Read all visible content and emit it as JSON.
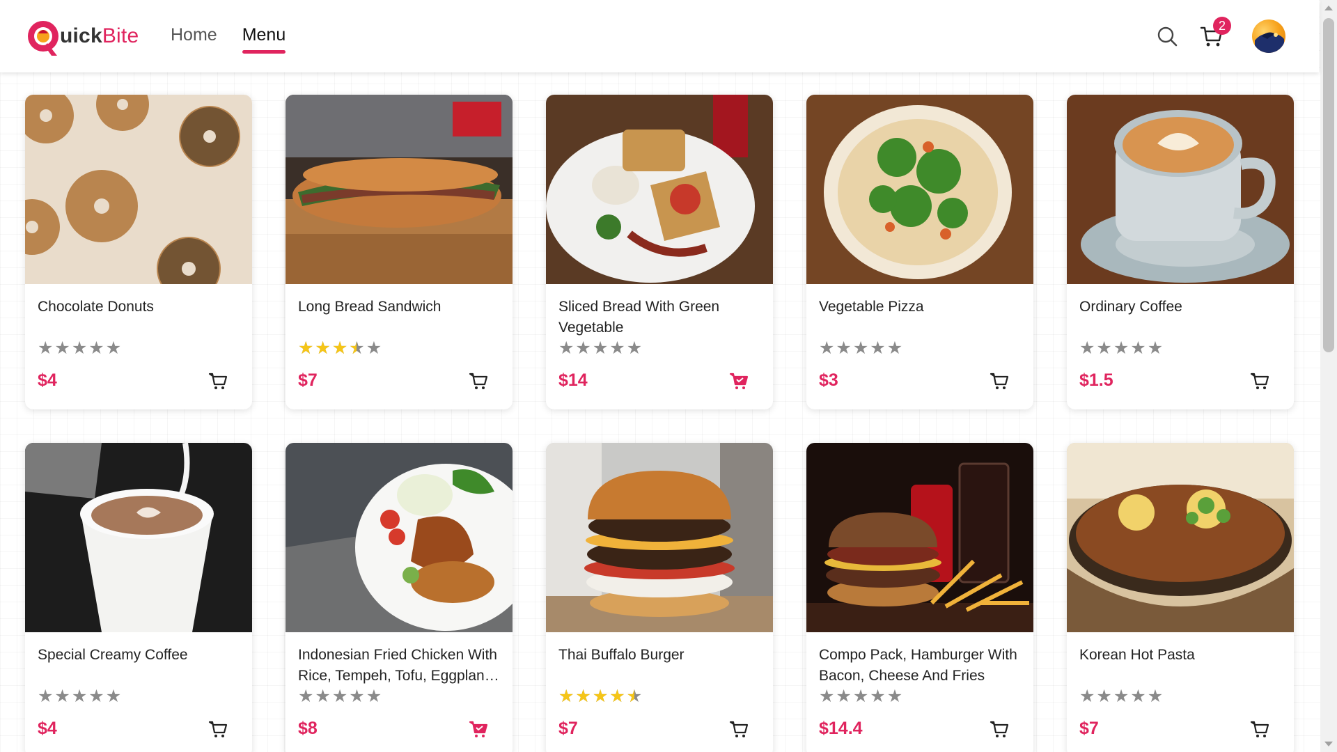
{
  "app": {
    "brand_first": "Q",
    "brand_mid": "uick",
    "brand_last": "Bite",
    "colors": {
      "accent": "#e0245e",
      "star": "#f5c518",
      "star_empty": "#8a8a8a"
    }
  },
  "nav": {
    "items": [
      {
        "label": "Home",
        "active": false
      },
      {
        "label": "Menu",
        "active": true
      }
    ]
  },
  "header": {
    "search_icon": "search-icon",
    "cart_icon": "cart-icon",
    "cart_count": "2",
    "avatar_icon": "user-avatar"
  },
  "products": [
    {
      "name": "Chocolate Donuts",
      "price": "$4",
      "rating": 0,
      "in_cart": false,
      "image": "bagels"
    },
    {
      "name": "Long Bread Sandwich",
      "price": "$7",
      "rating": 3.5,
      "in_cart": false,
      "image": "sandwich"
    },
    {
      "name": "Sliced Bread With Green Vegetable",
      "price": "$14",
      "rating": 0,
      "in_cart": true,
      "image": "toast-plate"
    },
    {
      "name": "Vegetable Pizza",
      "price": "$3",
      "rating": 0,
      "in_cart": false,
      "image": "pizza"
    },
    {
      "name": "Ordinary Coffee",
      "price": "$1.5",
      "rating": 0,
      "in_cart": false,
      "image": "coffee-cup"
    },
    {
      "name": "Special Creamy Coffee",
      "price": "$4",
      "rating": 0,
      "in_cart": false,
      "image": "latte-pour"
    },
    {
      "name": "Indonesian Fried Chicken With Rice, Tempeh, Tofu, Eggplant, Lalapan & Sambal",
      "price": "$8",
      "rating": 0,
      "in_cart": true,
      "image": "fried-chicken"
    },
    {
      "name": "Thai Buffalo Burger",
      "price": "$7",
      "rating": 4.5,
      "in_cart": false,
      "image": "burger"
    },
    {
      "name": "Compo Pack, Hamburger With Bacon, Cheese And Fries",
      "price": "$14.4",
      "rating": 0,
      "in_cart": false,
      "image": "burger-combo"
    },
    {
      "name": "Korean Hot Pasta",
      "price": "$7",
      "rating": 0,
      "in_cart": false,
      "image": "noodle-bowl"
    }
  ]
}
